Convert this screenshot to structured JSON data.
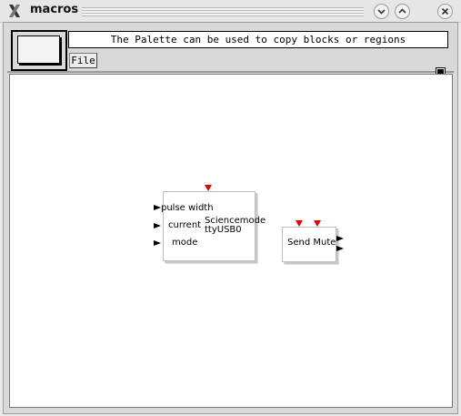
{
  "window": {
    "title": "macros",
    "buttons": [
      "minimize-icon",
      "maximize-icon",
      "close-icon"
    ]
  },
  "palette": {
    "message": "The Palette can be used to copy blocks or regions",
    "menu": {
      "file_label": "File"
    }
  },
  "diagram": {
    "blocks": [
      {
        "id": "sciencemode",
        "inputs": [
          "pulse width",
          "current",
          "mode"
        ],
        "name_lines": [
          "Sciencemode",
          "ttyUSB0"
        ],
        "event_inputs": 1
      },
      {
        "id": "send-mute",
        "label": "Send Mute",
        "outputs": 2,
        "event_inputs": 2
      }
    ]
  },
  "colors": {
    "event_port": "#e00000",
    "data_port": "#000000",
    "canvas": "#ffffff",
    "frame": "#d9d9d9"
  }
}
